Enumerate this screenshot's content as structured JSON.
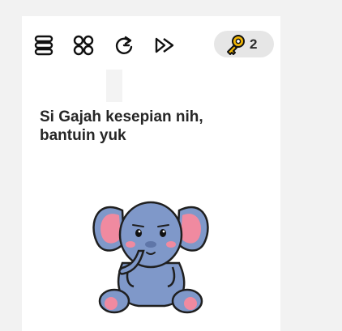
{
  "toolbar": {
    "menu_icon": "stacked-lines-icon",
    "levels_icon": "grid-circles-icon",
    "restart_icon": "restart-icon",
    "skip_icon": "skip-forward-icon",
    "key_icon": "key-icon",
    "key_count": "2"
  },
  "level": {
    "question": "Si Gajah kesepian nih, bantuin yuk"
  },
  "colors": {
    "key": "#f2b705",
    "elephant_body": "#7f98c9",
    "elephant_ear_inner": "#f08aa0",
    "pill_bg": "#e6e6e6"
  }
}
